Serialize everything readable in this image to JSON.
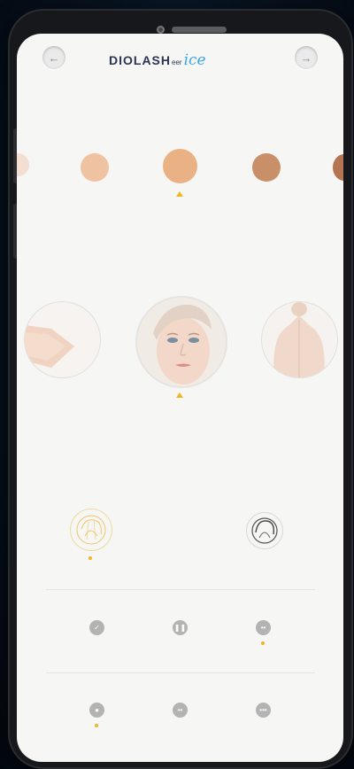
{
  "header": {
    "back_icon": "arrow-left-icon",
    "forward_icon": "arrow-right-icon",
    "logo_main": "DIOLASH",
    "logo_sub": "eer",
    "logo_ice": "ice"
  },
  "skin_tones": {
    "colors": [
      "#f3d4c2",
      "#efc2a2",
      "#eab185",
      "#c98f68",
      "#b57552"
    ],
    "selected_index": 2
  },
  "body_areas": {
    "items": [
      "arm",
      "face",
      "back"
    ],
    "selected_index": 1
  },
  "hair_options": {
    "items": [
      "hair-light-icon",
      "hair-dark-icon"
    ],
    "selected_index": 0
  },
  "mode_row_1": {
    "items": [
      "check-icon",
      "pause-icon",
      "more-icon"
    ],
    "selected_index": 2
  },
  "mode_row_2": {
    "items": [
      "mode-a-icon",
      "mode-b-icon",
      "mode-c-icon"
    ],
    "selected_index": 0
  },
  "colors": {
    "accent": "#f2b321",
    "brand": "#2b3553",
    "ice": "#3aa8e6"
  }
}
